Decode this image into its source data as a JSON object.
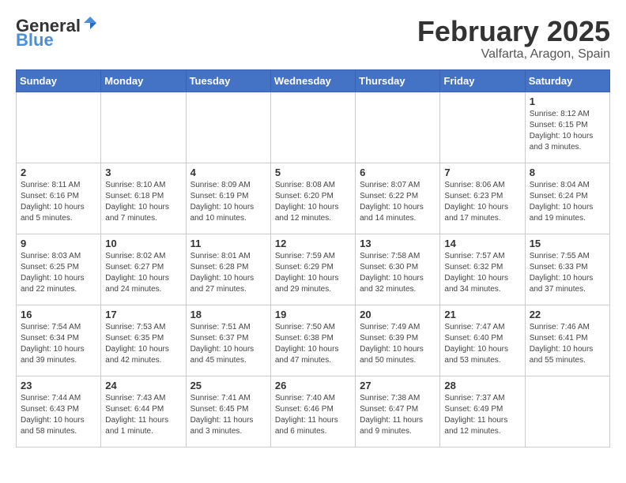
{
  "header": {
    "logo_general": "General",
    "logo_blue": "Blue",
    "title": "February 2025",
    "subtitle": "Valfarta, Aragon, Spain"
  },
  "days_of_week": [
    "Sunday",
    "Monday",
    "Tuesday",
    "Wednesday",
    "Thursday",
    "Friday",
    "Saturday"
  ],
  "weeks": [
    {
      "days": [
        {
          "num": "",
          "info": ""
        },
        {
          "num": "",
          "info": ""
        },
        {
          "num": "",
          "info": ""
        },
        {
          "num": "",
          "info": ""
        },
        {
          "num": "",
          "info": ""
        },
        {
          "num": "",
          "info": ""
        },
        {
          "num": "1",
          "info": "Sunrise: 8:12 AM\nSunset: 6:15 PM\nDaylight: 10 hours\nand 3 minutes."
        }
      ]
    },
    {
      "days": [
        {
          "num": "2",
          "info": "Sunrise: 8:11 AM\nSunset: 6:16 PM\nDaylight: 10 hours\nand 5 minutes."
        },
        {
          "num": "3",
          "info": "Sunrise: 8:10 AM\nSunset: 6:18 PM\nDaylight: 10 hours\nand 7 minutes."
        },
        {
          "num": "4",
          "info": "Sunrise: 8:09 AM\nSunset: 6:19 PM\nDaylight: 10 hours\nand 10 minutes."
        },
        {
          "num": "5",
          "info": "Sunrise: 8:08 AM\nSunset: 6:20 PM\nDaylight: 10 hours\nand 12 minutes."
        },
        {
          "num": "6",
          "info": "Sunrise: 8:07 AM\nSunset: 6:22 PM\nDaylight: 10 hours\nand 14 minutes."
        },
        {
          "num": "7",
          "info": "Sunrise: 8:06 AM\nSunset: 6:23 PM\nDaylight: 10 hours\nand 17 minutes."
        },
        {
          "num": "8",
          "info": "Sunrise: 8:04 AM\nSunset: 6:24 PM\nDaylight: 10 hours\nand 19 minutes."
        }
      ]
    },
    {
      "days": [
        {
          "num": "9",
          "info": "Sunrise: 8:03 AM\nSunset: 6:25 PM\nDaylight: 10 hours\nand 22 minutes."
        },
        {
          "num": "10",
          "info": "Sunrise: 8:02 AM\nSunset: 6:27 PM\nDaylight: 10 hours\nand 24 minutes."
        },
        {
          "num": "11",
          "info": "Sunrise: 8:01 AM\nSunset: 6:28 PM\nDaylight: 10 hours\nand 27 minutes."
        },
        {
          "num": "12",
          "info": "Sunrise: 7:59 AM\nSunset: 6:29 PM\nDaylight: 10 hours\nand 29 minutes."
        },
        {
          "num": "13",
          "info": "Sunrise: 7:58 AM\nSunset: 6:30 PM\nDaylight: 10 hours\nand 32 minutes."
        },
        {
          "num": "14",
          "info": "Sunrise: 7:57 AM\nSunset: 6:32 PM\nDaylight: 10 hours\nand 34 minutes."
        },
        {
          "num": "15",
          "info": "Sunrise: 7:55 AM\nSunset: 6:33 PM\nDaylight: 10 hours\nand 37 minutes."
        }
      ]
    },
    {
      "days": [
        {
          "num": "16",
          "info": "Sunrise: 7:54 AM\nSunset: 6:34 PM\nDaylight: 10 hours\nand 39 minutes."
        },
        {
          "num": "17",
          "info": "Sunrise: 7:53 AM\nSunset: 6:35 PM\nDaylight: 10 hours\nand 42 minutes."
        },
        {
          "num": "18",
          "info": "Sunrise: 7:51 AM\nSunset: 6:37 PM\nDaylight: 10 hours\nand 45 minutes."
        },
        {
          "num": "19",
          "info": "Sunrise: 7:50 AM\nSunset: 6:38 PM\nDaylight: 10 hours\nand 47 minutes."
        },
        {
          "num": "20",
          "info": "Sunrise: 7:49 AM\nSunset: 6:39 PM\nDaylight: 10 hours\nand 50 minutes."
        },
        {
          "num": "21",
          "info": "Sunrise: 7:47 AM\nSunset: 6:40 PM\nDaylight: 10 hours\nand 53 minutes."
        },
        {
          "num": "22",
          "info": "Sunrise: 7:46 AM\nSunset: 6:41 PM\nDaylight: 10 hours\nand 55 minutes."
        }
      ]
    },
    {
      "days": [
        {
          "num": "23",
          "info": "Sunrise: 7:44 AM\nSunset: 6:43 PM\nDaylight: 10 hours\nand 58 minutes."
        },
        {
          "num": "24",
          "info": "Sunrise: 7:43 AM\nSunset: 6:44 PM\nDaylight: 11 hours\nand 1 minute."
        },
        {
          "num": "25",
          "info": "Sunrise: 7:41 AM\nSunset: 6:45 PM\nDaylight: 11 hours\nand 3 minutes."
        },
        {
          "num": "26",
          "info": "Sunrise: 7:40 AM\nSunset: 6:46 PM\nDaylight: 11 hours\nand 6 minutes."
        },
        {
          "num": "27",
          "info": "Sunrise: 7:38 AM\nSunset: 6:47 PM\nDaylight: 11 hours\nand 9 minutes."
        },
        {
          "num": "28",
          "info": "Sunrise: 7:37 AM\nSunset: 6:49 PM\nDaylight: 11 hours\nand 12 minutes."
        },
        {
          "num": "",
          "info": ""
        }
      ]
    }
  ]
}
